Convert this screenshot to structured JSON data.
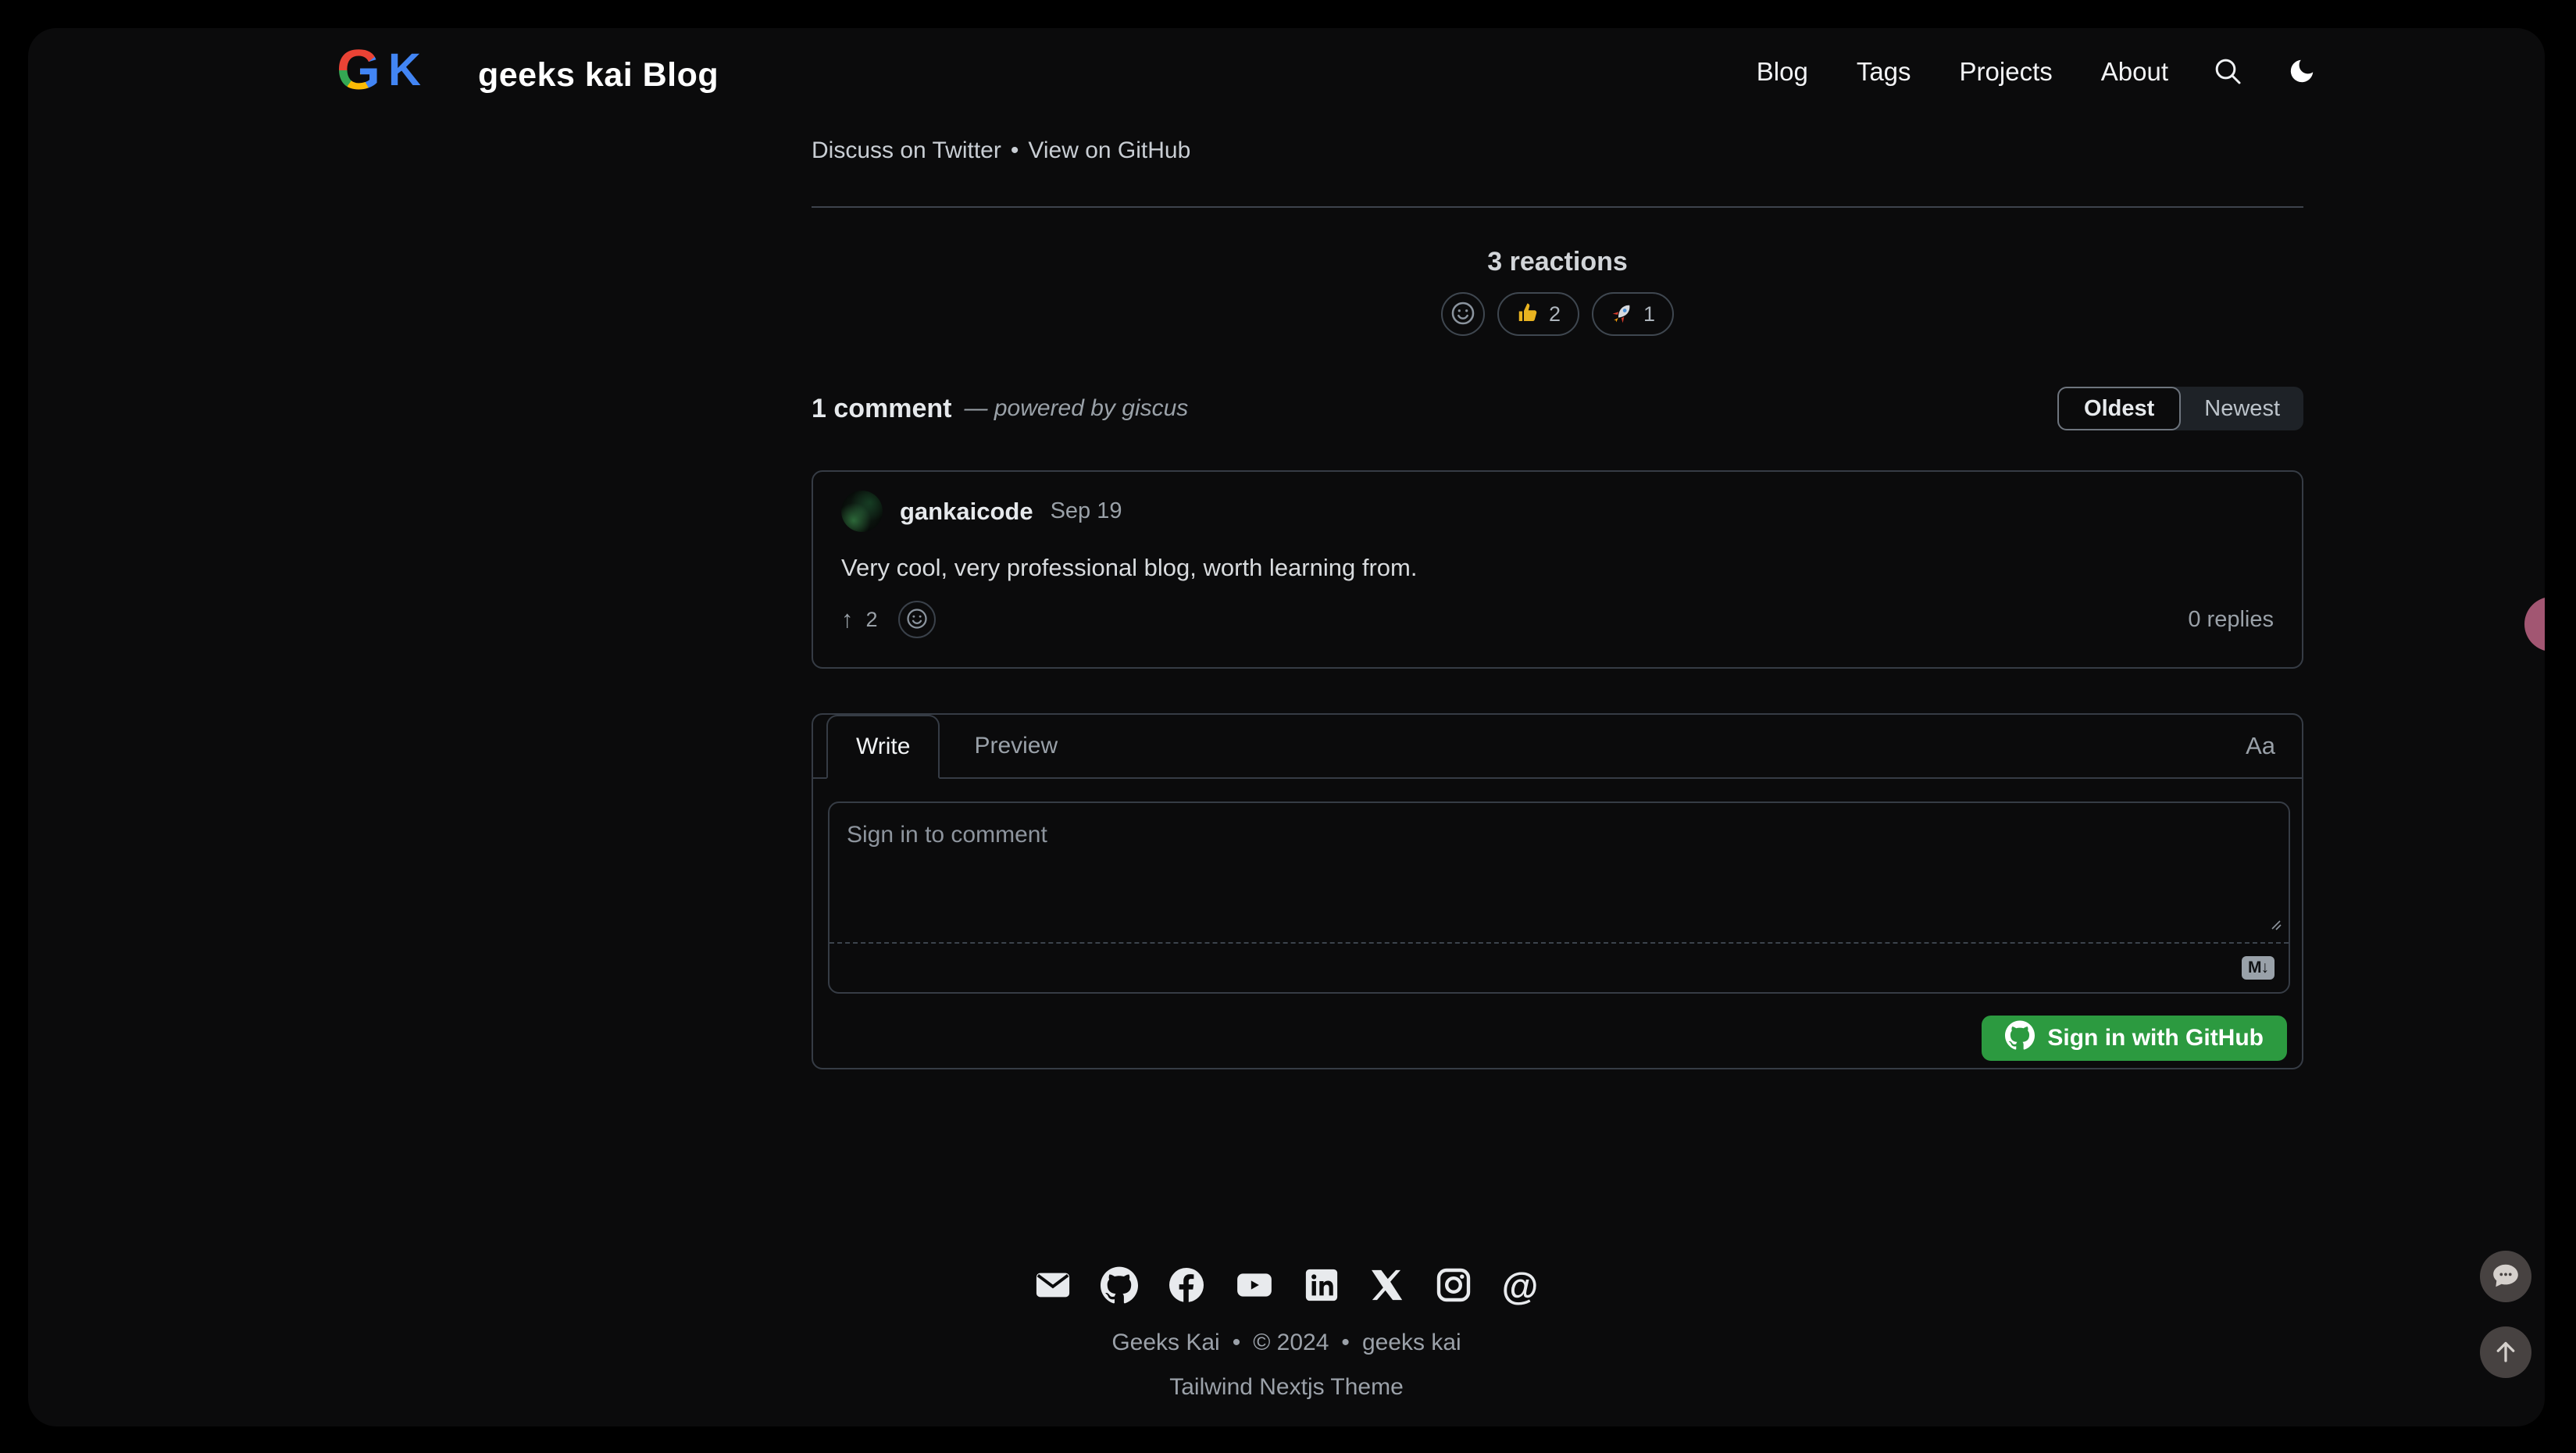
{
  "header": {
    "logo_g": "G",
    "logo_k": "K",
    "title": "geeks kai Blog",
    "nav": [
      {
        "label": "Blog"
      },
      {
        "label": "Tags"
      },
      {
        "label": "Projects"
      },
      {
        "label": "About"
      }
    ]
  },
  "post_links": {
    "discuss": "Discuss on Twitter",
    "separator": "•",
    "view": "View on GitHub"
  },
  "reactions": {
    "heading": "3 reactions",
    "items": [
      {
        "emoji": "thumbs-up",
        "count": "2"
      },
      {
        "emoji": "rocket",
        "count": "1"
      }
    ]
  },
  "comments": {
    "count_label": "1 comment",
    "powered_by": "— powered by giscus",
    "sort": {
      "oldest": "Oldest",
      "newest": "Newest",
      "selected": "Oldest"
    },
    "comment": {
      "author": "gankaicode",
      "date": "Sep 19",
      "body": "Very cool, very professional blog, worth learning from.",
      "upvote_glyph": "↑",
      "upvotes": "2",
      "replies": "0 replies"
    }
  },
  "composer": {
    "tabs": {
      "write": "Write",
      "preview": "Preview"
    },
    "format_label": "Aa",
    "placeholder": "Sign in to comment",
    "markdown_badge": "M↓",
    "signin_label": "Sign in with GitHub"
  },
  "footer": {
    "icons": [
      "mail-icon",
      "github-icon",
      "facebook-icon",
      "youtube-icon",
      "linkedin-icon",
      "x-icon",
      "instagram-icon",
      "threads-icon"
    ],
    "threads_glyph": "@",
    "copyright": {
      "name": "Geeks Kai",
      "separator": "•",
      "year": "© 2024",
      "site": "geeks kai"
    },
    "theme_link": "Tailwind Nextjs Theme"
  },
  "colors": {
    "page_bg": "#0b0b0c",
    "frame_bg": "#000000",
    "border": "#363c45",
    "accent_green": "#2c9a40",
    "logo_blue": "#4285f4",
    "pink_peek": "#a25672",
    "text_muted": "#9aa1a8"
  }
}
